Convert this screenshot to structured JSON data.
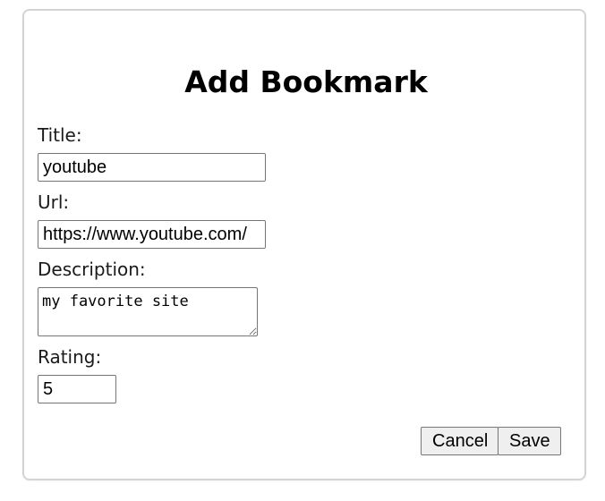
{
  "form": {
    "heading": "Add Bookmark",
    "title_label": "Title:",
    "title_value": "youtube",
    "url_label": "Url:",
    "url_value": "https://www.youtube.com/",
    "description_label": "Description:",
    "description_value": "my favorite site",
    "rating_label": "Rating:",
    "rating_value": "5",
    "cancel_label": "Cancel",
    "save_label": "Save"
  }
}
